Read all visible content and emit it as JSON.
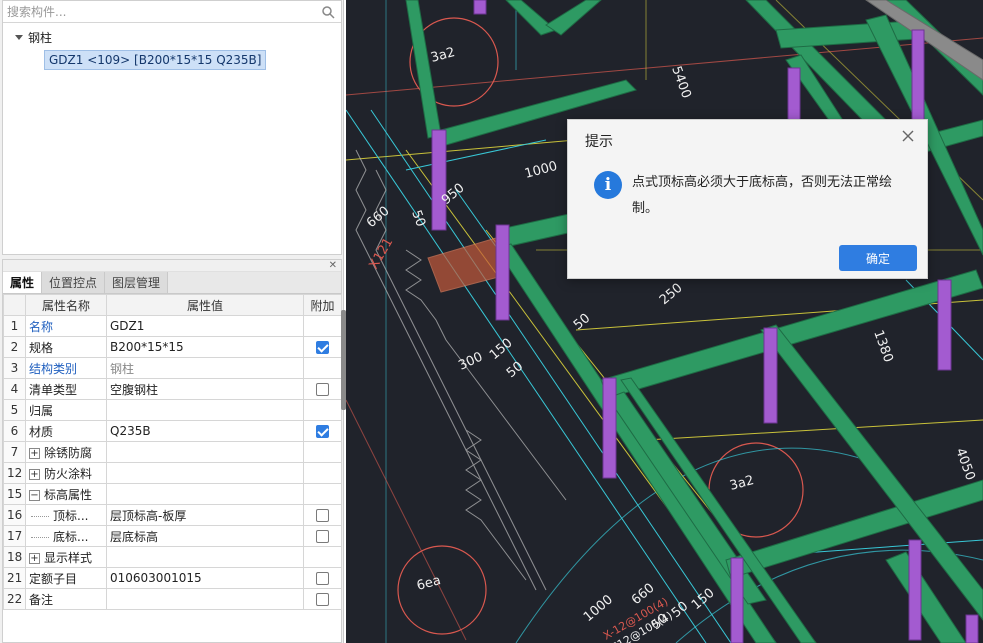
{
  "tree": {
    "search_placeholder": "搜索构件...",
    "group_label": "钢柱",
    "item_label": "GDZ1 <109> [B200*15*15 Q235B]"
  },
  "prop_panel": {
    "tabs": [
      {
        "label": "属性",
        "active": true
      },
      {
        "label": "位置控点",
        "active": false
      },
      {
        "label": "图层管理",
        "active": false
      }
    ],
    "headers": {
      "name": "属性名称",
      "value": "属性值",
      "extra": "附加"
    },
    "rows": [
      {
        "idx": "1",
        "name": "名称",
        "value": "GDZ1",
        "checkbox": "none",
        "name_style": "blue"
      },
      {
        "idx": "2",
        "name": "规格",
        "value": "B200*15*15",
        "checkbox": "checked"
      },
      {
        "idx": "3",
        "name": "结构类别",
        "value": "钢柱",
        "checkbox": "none",
        "name_style": "blue",
        "value_style": "muted"
      },
      {
        "idx": "4",
        "name": "清单类型",
        "value": "空腹钢柱",
        "checkbox": "unchecked"
      },
      {
        "idx": "5",
        "name": "归属",
        "value": "",
        "checkbox": "none"
      },
      {
        "idx": "6",
        "name": "材质",
        "value": "Q235B",
        "checkbox": "checked"
      },
      {
        "idx": "7",
        "name": "除锈防腐",
        "value": "",
        "checkbox": "none",
        "expander": "+"
      },
      {
        "idx": "12",
        "name": "防火涂料",
        "value": "",
        "checkbox": "none",
        "expander": "+"
      },
      {
        "idx": "15",
        "name": "标高属性",
        "value": "",
        "checkbox": "none",
        "expander": "−"
      },
      {
        "idx": "16",
        "name": "顶标...",
        "value": "层顶标高-板厚",
        "checkbox": "unchecked",
        "child": true
      },
      {
        "idx": "17",
        "name": "底标...",
        "value": "层底标高",
        "checkbox": "unchecked",
        "child": true
      },
      {
        "idx": "18",
        "name": "显示样式",
        "value": "",
        "checkbox": "none",
        "expander": "+"
      },
      {
        "idx": "21",
        "name": "定额子目",
        "value": "010603001015",
        "checkbox": "unchecked"
      },
      {
        "idx": "22",
        "name": "备注",
        "value": "",
        "checkbox": "unchecked"
      }
    ]
  },
  "dialog": {
    "title": "提示",
    "message": "点式顶标高必须大于底标高，否则无法正常绘制。",
    "ok_label": "确定",
    "info_glyph": "i"
  },
  "cad": {
    "labels": [
      "3a2",
      "5400",
      "1000",
      "950",
      "660",
      "50",
      "X121",
      "250",
      "50",
      "300",
      "150",
      "50",
      "1380",
      "4050",
      "3a2",
      "6ea",
      "1000",
      "660",
      "50",
      "150",
      "50",
      "X-12@100(4)",
      "E12@100(4)"
    ],
    "colors": {
      "background": "#20232b",
      "beam": "#2e9a63",
      "column": "#a35bd0",
      "yellow_line": "#c9c23a",
      "cyan_line": "#38c7d6",
      "red_line": "#d9584f"
    }
  }
}
